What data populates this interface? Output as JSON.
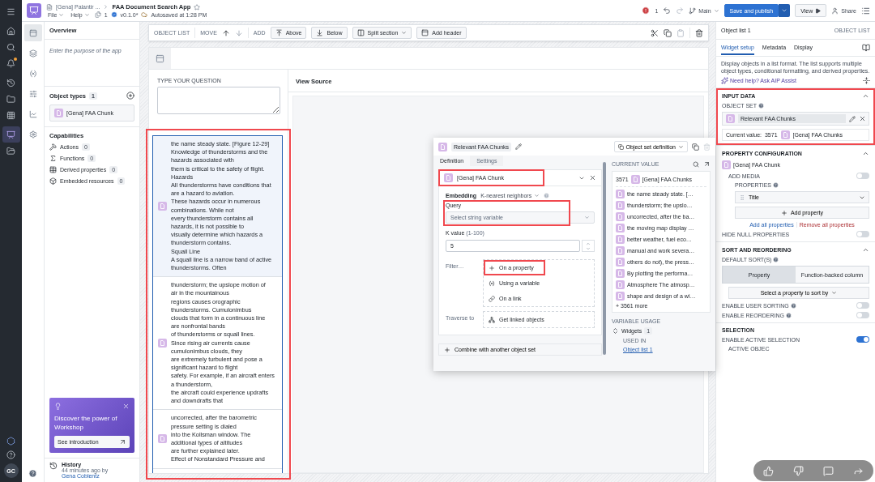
{
  "global_nav": [
    {
      "selected": false
    },
    {
      "selected": false
    },
    {
      "selected": false
    },
    {
      "selected": false
    },
    {
      "selected": false
    },
    {
      "selected": false
    },
    {
      "selected": false
    },
    {
      "selected": true
    },
    {
      "selected": false
    }
  ],
  "user_initials": "GC",
  "app_header": {
    "breadcrumb_parent": "[Gena] Palantir ...",
    "title": "FAA Document Search App",
    "starred": false,
    "menus": [
      "File",
      "Help"
    ],
    "page_count": "1",
    "version": "v0.1.0*",
    "autosave": "Autosaved at 1:28 PM",
    "error_count": "1",
    "branch": "Main",
    "publish_button": "Save and publish",
    "view_button": "View",
    "share_button": "Share"
  },
  "icon_rail": [
    {
      "selected": true
    },
    {
      "selected": false
    },
    {
      "selected": false
    },
    {
      "selected": false
    },
    {
      "selected": false
    },
    {
      "selected": false
    }
  ],
  "overview": {
    "title": "Overview",
    "purpose_placeholder": "Enter the purpose of the app",
    "object_types_title": "Object types",
    "object_types_count": "1",
    "object_types": [
      "[Gena] FAA Chunk"
    ],
    "capabilities_title": "Capabilities",
    "capabilities": [
      {
        "label": "Actions",
        "count": "0"
      },
      {
        "label": "Functions",
        "count": "0"
      },
      {
        "label": "Derived properties",
        "count": "0"
      },
      {
        "label": "Embedded resources",
        "count": "0"
      }
    ],
    "promo": {
      "title": "Discover the power of Workshop",
      "button": "See introduction"
    },
    "history": {
      "title": "History",
      "time": "44 minutes ago by",
      "user": "Gena Coblentz"
    }
  },
  "toolbar": {
    "label": "OBJECT LIST",
    "move_label": "MOVE",
    "add_label": "ADD",
    "buttons": [
      "Above",
      "Below",
      "Split section",
      "Add header"
    ]
  },
  "page": {
    "question_label": "TYPE YOUR QUESTION",
    "view_source_title": "View Source",
    "list_items": [
      {
        "selected": true,
        "text": "the name steady state. [Figure 12-29]\nKnowledge of thunderstorms and the\nhazards associated with\nthem is critical to the safety of flight.\nHazards\nAll thunderstorms have conditions that\nare a hazard to aviation.\nThese hazards occur in numerous\ncombinations. While not\nevery thunderstorm contains all\nhazards, it is not possible to\nvisually determine which hazards a\nthunderstorm contains.\nSquall Line\nA squall line is a narrow band of active\nthunderstorms. Often"
      },
      {
        "selected": false,
        "text": "thunderstorm; the upslope motion of\nair in the mountainous\nregions causes orographic\nthunderstorms. Cumulonimbus\nclouds that form in a continuous line\nare nonfrontal bands\nof thunderstorms or squall lines.\nSince rising air currents cause\ncumulonimbus clouds, they\nare extremely turbulent and pose a\nsignificant hazard to flight\nsafety. For example, if an aircraft enters\na thunderstorm,\nthe aircraft could experience updrafts\nand downdrafts that"
      },
      {
        "selected": false,
        "text": "uncorrected, after the barometric\npressure setting is dialed\ninto the Kollsman window. The\nadditional types of altitudes\nare further explained later.\nEffect of Nonstandard Pressure and"
      }
    ]
  },
  "popup": {
    "title": "Relevant FAA Chunks",
    "definition_type": "Object set definition",
    "tabs": [
      {
        "label": "Definition",
        "selected": true
      },
      {
        "label": "Settings",
        "selected": false
      }
    ],
    "object_type": "[Gena] FAA Chunk",
    "embedding_label": "Embedding",
    "embedding_method": "K-nearest neighbors",
    "query_label": "Query",
    "query_placeholder": "Select string variable",
    "k_label": "K value",
    "k_range": "(1-100)",
    "k_value": "5",
    "filter_label": "Filter…",
    "filter_options": [
      {
        "kind": "property",
        "label": "On a property"
      },
      {
        "kind": "variable",
        "label": "Using a variable"
      },
      {
        "kind": "link",
        "label": "On a link"
      }
    ],
    "traverse_label": "Traverse to",
    "traverse_option": "Get linked objects",
    "combine_button": "Combine with another object set",
    "current_value_title": "CURRENT VALUE",
    "current_count": "3571",
    "current_type": "[Gena] FAA Chunks",
    "current_items": [
      "the name steady state. […",
      "thunderstorm; the upslo…",
      "uncorrected, after the ba…",
      "the moving map display …",
      "better weather, fuel eco…",
      "manual and work severa…",
      "others do not), the press…",
      "By plotting the performa…",
      "Atmosphere The atmosp…",
      "shape and design of a wi…"
    ],
    "more": "+ 3561 more",
    "variable_usage_title": "VARIABLE USAGE",
    "widgets_label": "Widgets",
    "widgets_count": "1",
    "used_in_label": "USED IN",
    "used_in_link": "Object list 1"
  },
  "right_panel": {
    "title": "Object list 1",
    "type_label": "OBJECT LIST",
    "tabs": [
      {
        "label": "Widget setup",
        "selected": true
      },
      {
        "label": "Metadata",
        "selected": false
      },
      {
        "label": "Display",
        "selected": false
      }
    ],
    "description": "Display objects in a list format. The list supports multiple object types, conditional formatting, and derived properties.",
    "help_link": "Need help? Ask AIP Assist",
    "input_data": {
      "title": "INPUT DATA",
      "expanded": true,
      "object_set_label": "OBJECT SET",
      "object_set": "Relevant FAA Chunks",
      "current_label": "Current value:",
      "current_count": "3571",
      "current_type": "[Gena] FAA Chunks"
    },
    "property_configuration": {
      "title": "PROPERTY CONFIGURATION",
      "expanded": true,
      "object_type": "[Gena] FAA Chunk",
      "add_media_label": "ADD MEDIA",
      "add_media_on": false,
      "properties_label": "PROPERTIES",
      "properties": [
        "Title"
      ],
      "add_property": "Add property",
      "add_all": "Add all properties",
      "remove_all": "Remove all properties",
      "hide_null_label": "HIDE NULL PROPERTIES",
      "hide_null_on": false
    },
    "sort": {
      "title": "SORT AND REORDERING",
      "expanded": true,
      "default_sort_label": "DEFAULT SORT(S)",
      "modes": [
        {
          "label": "Property",
          "selected": true
        },
        {
          "label": "Function-backed column",
          "selected": false
        }
      ],
      "sort_select": "Select a property to sort by",
      "user_sorting_label": "ENABLE USER SORTING",
      "user_sorting_on": false,
      "reordering_label": "ENABLE REORDERING",
      "reordering_on": false
    },
    "selection": {
      "title": "SELECTION",
      "active_selection_label": "ENABLE ACTIVE SELECTION",
      "active_selection_on": true,
      "active_object_label": "ACTIVE OBJEC"
    }
  }
}
